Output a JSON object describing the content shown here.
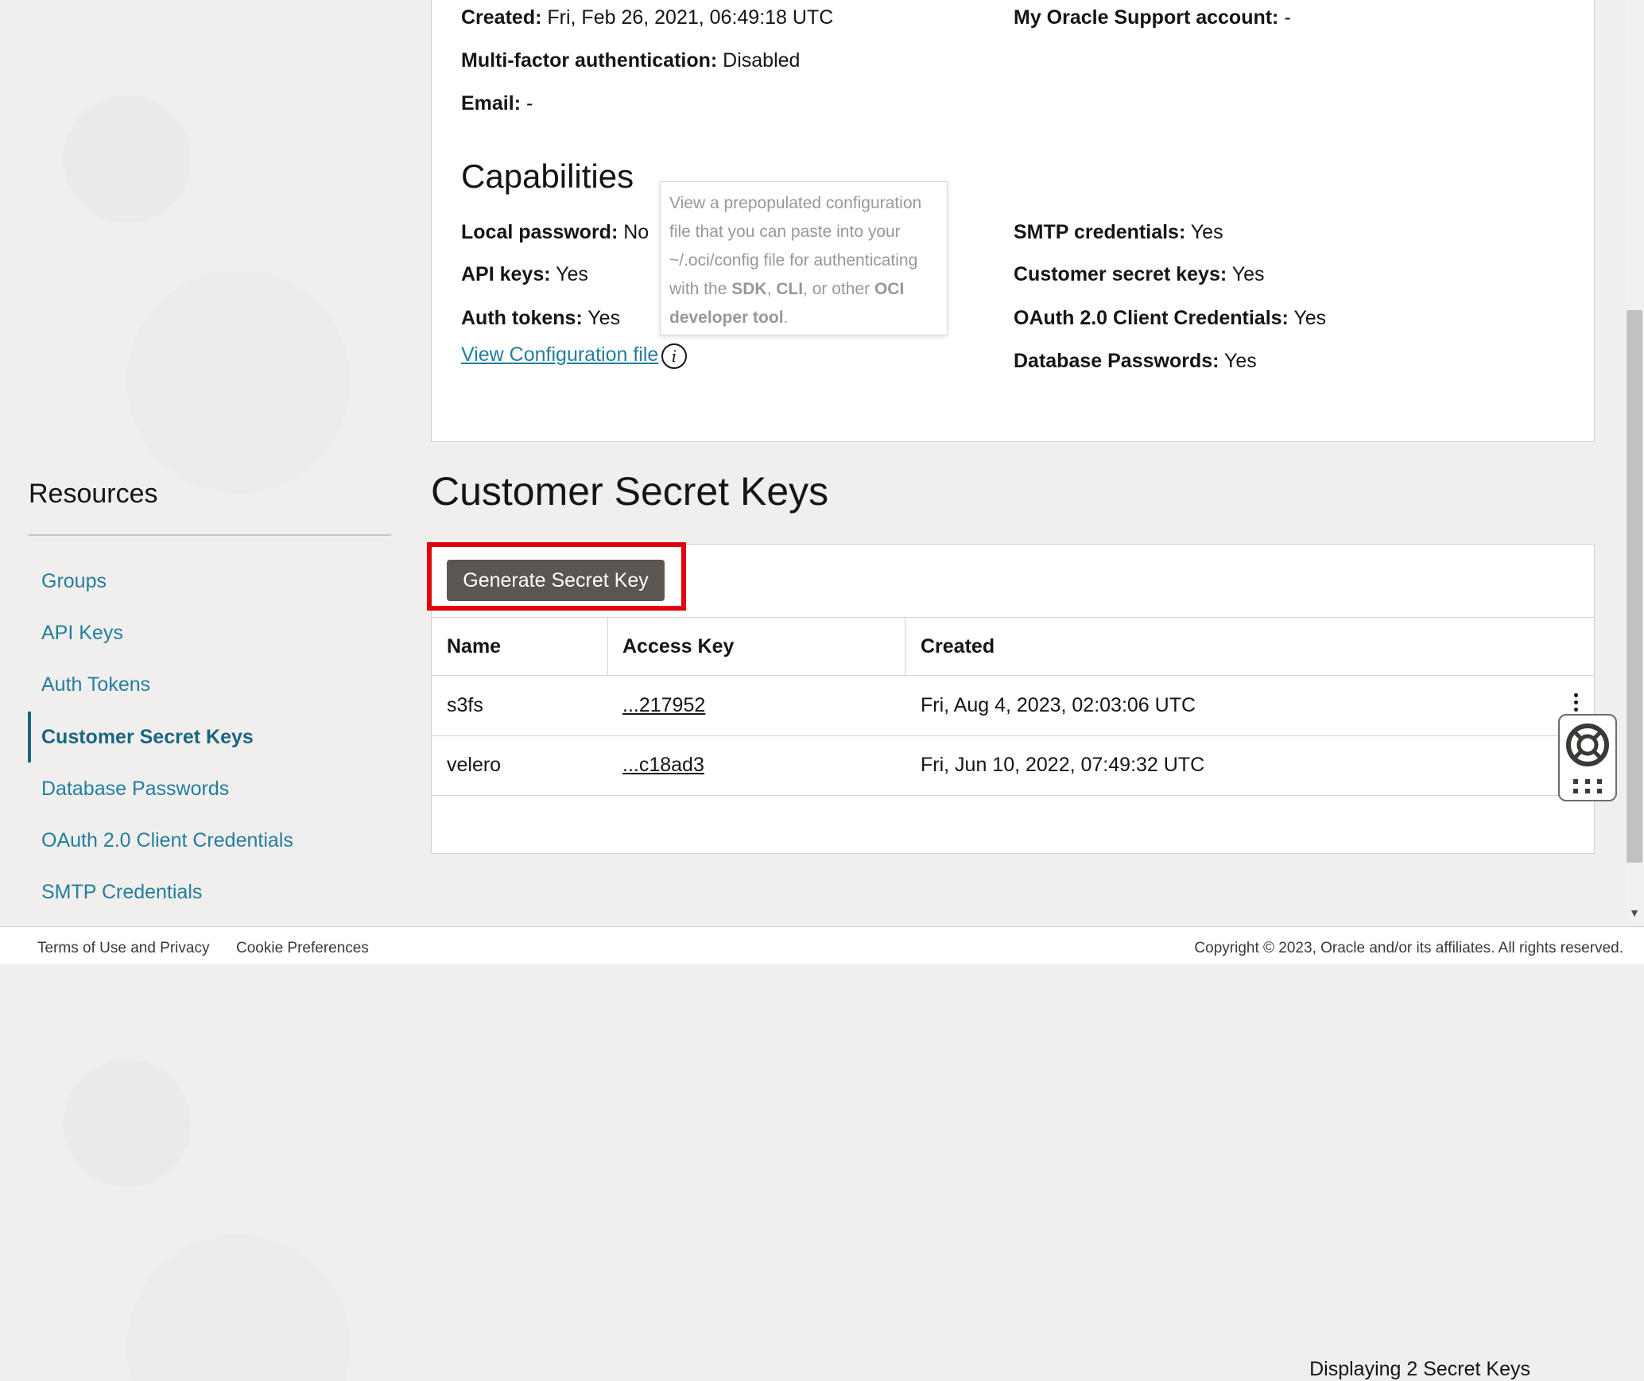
{
  "user_details": {
    "created_label": "Created:",
    "created_value": "Fri, Feb 26, 2021, 06:49:18 UTC",
    "mfa_label": "Multi-factor authentication:",
    "mfa_value": "Disabled",
    "email_label": "Email:",
    "email_value": "-",
    "mos_label": "My Oracle Support account:",
    "mos_value": "-"
  },
  "capabilities": {
    "title": "Capabilities",
    "left": [
      {
        "label": "Local password:",
        "value": "No"
      },
      {
        "label": "API keys:",
        "value": "Yes"
      },
      {
        "label": "Auth tokens:",
        "value": "Yes"
      }
    ],
    "right": [
      {
        "label": "SMTP credentials:",
        "value": "Yes"
      },
      {
        "label": "Customer secret keys:",
        "value": "Yes"
      },
      {
        "label": "OAuth 2.0 Client Credentials:",
        "value": "Yes"
      },
      {
        "label": "Database Passwords:",
        "value": "Yes"
      }
    ],
    "view_config_link": "View Configuration file",
    "info_icon": "info-icon"
  },
  "tooltip": {
    "line1": "View a prepopulated configuration",
    "line2": "file that you can paste into your",
    "line3": "~/.oci/config file for authenticating",
    "line4_prefix": "with the ",
    "sdk": "SDK",
    "comma": ", ",
    "cli": "CLI",
    "or_other": ", or other ",
    "oci": "OCI",
    "developer_tool": "developer tool",
    "period": "."
  },
  "sidebar": {
    "title": "Resources",
    "items": [
      {
        "label": "Groups",
        "active": false
      },
      {
        "label": "API Keys",
        "active": false
      },
      {
        "label": "Auth Tokens",
        "active": false
      },
      {
        "label": "Customer Secret Keys",
        "active": true
      },
      {
        "label": "Database Passwords",
        "active": false
      },
      {
        "label": "OAuth 2.0 Client Credentials",
        "active": false
      },
      {
        "label": "SMTP Credentials",
        "active": false
      }
    ]
  },
  "main": {
    "heading": "Customer Secret Keys",
    "generate_button": "Generate Secret Key",
    "columns": [
      "Name",
      "Access Key",
      "Created"
    ],
    "rows": [
      {
        "name": "s3fs",
        "access_key": "...217952",
        "created": "Fri, Aug 4, 2023, 02:03:06 UTC"
      },
      {
        "name": "velero",
        "access_key": "...c18ad3",
        "created": "Fri, Jun 10, 2022, 07:49:32 UTC"
      }
    ],
    "footer": "Displaying 2 Secret Keys",
    "row_actions_icon": "kebab-menu-icon"
  },
  "help_widget": {
    "icon": "lifebuoy-icon",
    "grid_icon": "grid-icon"
  },
  "footer": {
    "terms": "Terms of Use and Privacy",
    "cookies": "Cookie Preferences",
    "copyright": "Copyright © 2023, Oracle and/or its affiliates. All rights reserved."
  },
  "colors": {
    "accent": "#227e9e",
    "highlight": "#e3000f",
    "button": "#5b5652"
  }
}
